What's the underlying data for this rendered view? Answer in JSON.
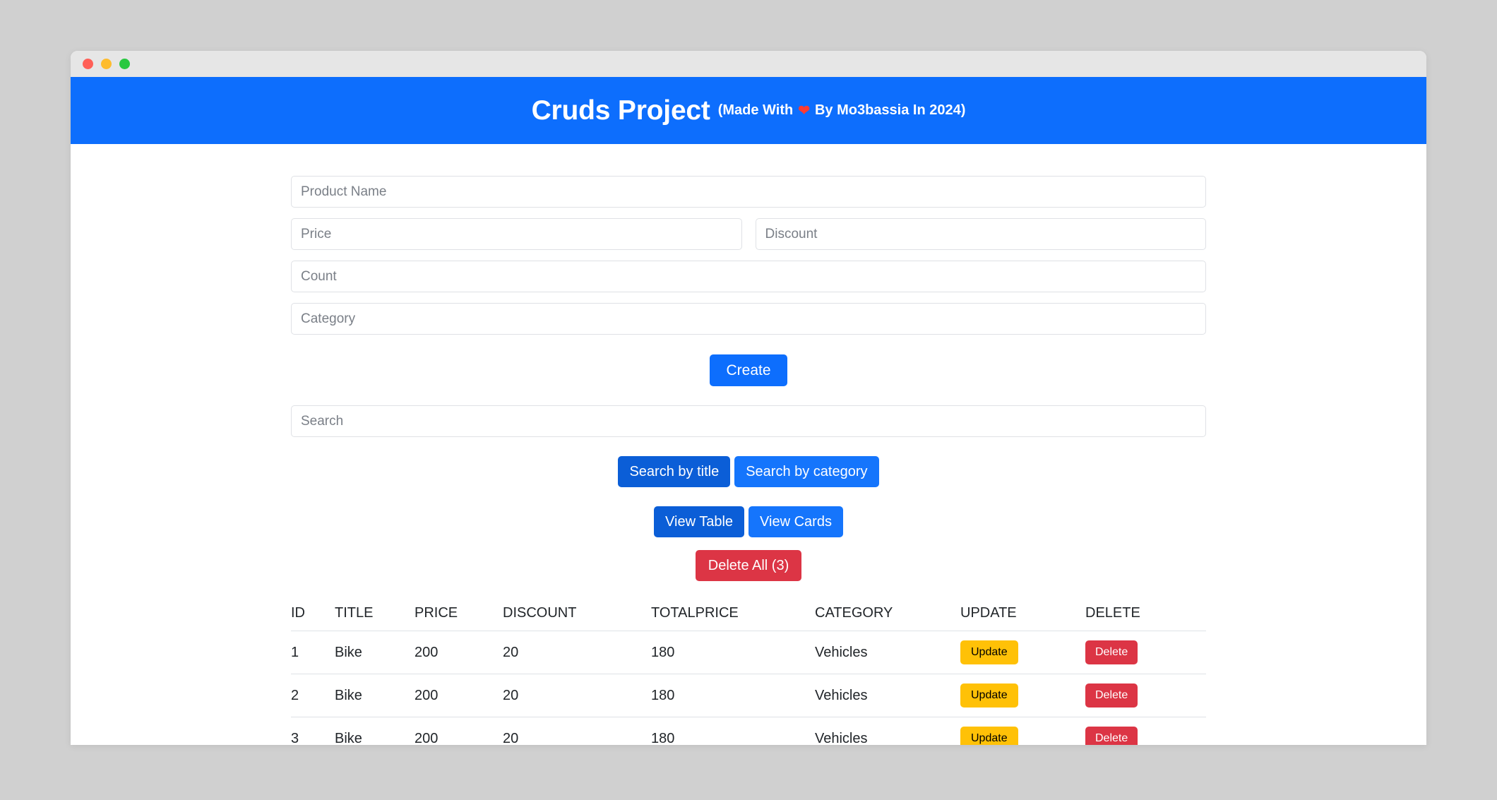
{
  "window": {
    "traffic_lights": [
      "close",
      "minimize",
      "maximize"
    ]
  },
  "header": {
    "title": "Cruds Project",
    "subtitle_before": "(Made With",
    "heart_icon": "heart-icon",
    "subtitle_after": "By Mo3bassia In 2024)",
    "background_color": "#0d6efd"
  },
  "form": {
    "product_name_placeholder": "Product Name",
    "product_name_value": "",
    "price_placeholder": "Price",
    "price_value": "",
    "discount_placeholder": "Discount",
    "discount_value": "",
    "count_placeholder": "Count",
    "count_value": "",
    "category_placeholder": "Category",
    "category_value": "",
    "create_label": "Create"
  },
  "search": {
    "placeholder": "Search",
    "value": "",
    "by_title_label": "Search by title",
    "by_category_label": "Search by category",
    "active_mode": "by_title"
  },
  "view": {
    "table_label": "View Table",
    "cards_label": "View Cards",
    "active_mode": "table"
  },
  "actions": {
    "delete_all_label": "Delete All (3)",
    "delete_all_count": 3,
    "danger_color": "#dc3545"
  },
  "table": {
    "headers": [
      "ID",
      "TITLE",
      "PRICE",
      "DISCOUNT",
      "TOTALPRICE",
      "CATEGORY",
      "UPDATE",
      "DELETE"
    ],
    "rows": [
      {
        "id": "1",
        "title": "Bike",
        "price": "200",
        "discount": "20",
        "totalprice": "180",
        "category": "Vehicles",
        "update_label": "Update",
        "delete_label": "Delete"
      },
      {
        "id": "2",
        "title": "Bike",
        "price": "200",
        "discount": "20",
        "totalprice": "180",
        "category": "Vehicles",
        "update_label": "Update",
        "delete_label": "Delete"
      },
      {
        "id": "3",
        "title": "Bike",
        "price": "200",
        "discount": "20",
        "totalprice": "180",
        "category": "Vehicles",
        "update_label": "Update",
        "delete_label": "Delete"
      }
    ]
  }
}
